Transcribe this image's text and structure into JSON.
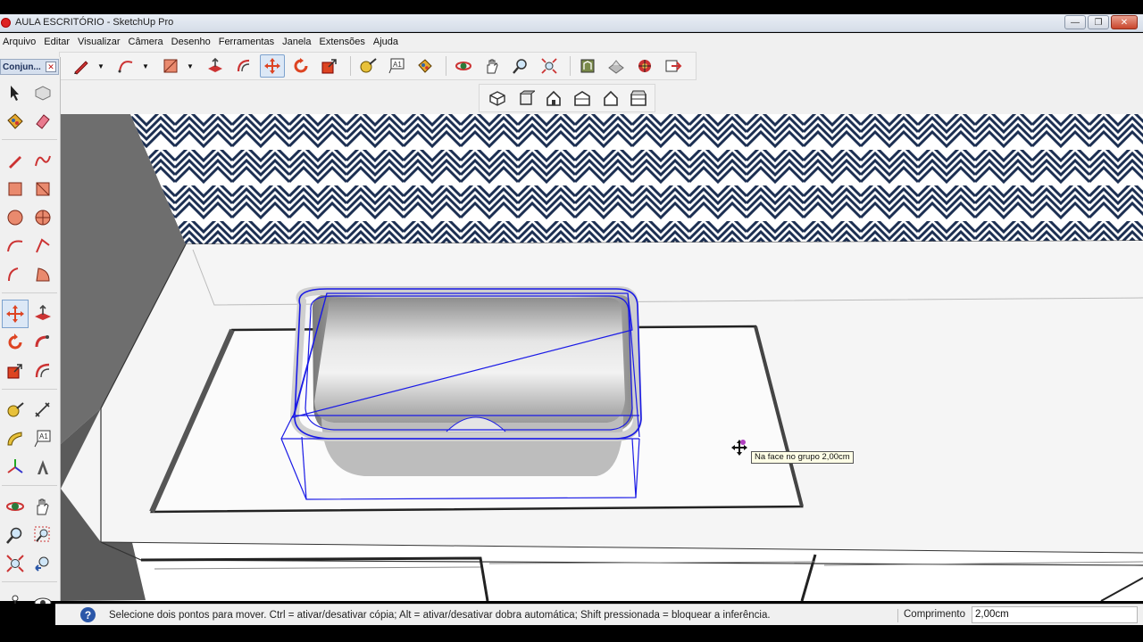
{
  "window": {
    "title": "AULA ESCRITÓRIO - SketchUp Pro",
    "minimize_glyph": "—",
    "maximize_glyph": "❐",
    "close_glyph": "✕"
  },
  "menu": [
    "Arquivo",
    "Editar",
    "Visualizar",
    "Câmera",
    "Desenho",
    "Ferramentas",
    "Janela",
    "Extensões",
    "Ajuda"
  ],
  "tray": {
    "title": "Conjun...",
    "close_glyph": "✕"
  },
  "tooltip": {
    "text": "Na face no grupo 2,00cm"
  },
  "status": {
    "help_glyph": "?",
    "message": "Selecione dois pontos para mover. Ctrl = ativar/desativar cópia; Alt = ativar/desativar dobra automática; Shift pressionada = bloquear a inferência.",
    "measure_label": "Comprimento",
    "measure_value": "2,00cm"
  },
  "colors": {
    "selection_blue": "#1a1ae6",
    "wallpaper_navy": "#1c2f52",
    "active_tool_bg": "#dce8f6"
  },
  "toolbar_icons": [
    "pencil-icon",
    "arc-icon",
    "rectangle-icon",
    "push-pull-icon",
    "offset-icon",
    "move-icon",
    "rotate-icon",
    "scale-icon",
    "tape-measure-icon",
    "text-icon",
    "paint-bucket-icon",
    "orbit-icon",
    "pan-icon",
    "zoom-icon",
    "zoom-extents-icon",
    "warehouse-icon",
    "extension-warehouse-icon",
    "components-icon",
    "send-to-layout-icon"
  ],
  "view_icons": [
    "iso-view-icon",
    "top-view-icon",
    "front-view-icon",
    "right-view-icon",
    "back-view-icon",
    "left-view-icon"
  ]
}
